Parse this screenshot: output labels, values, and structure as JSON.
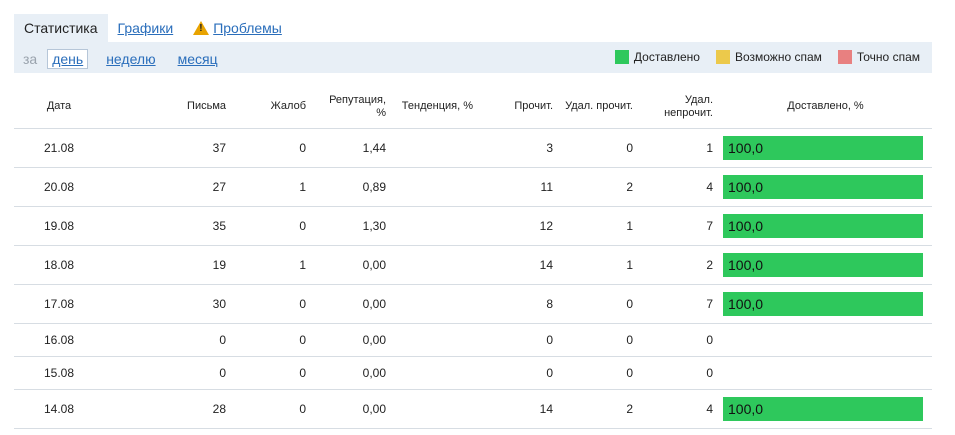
{
  "tabs": [
    {
      "label": "Статистика"
    },
    {
      "label": "Графики"
    },
    {
      "label": "Проблемы"
    }
  ],
  "period": {
    "prefix": "за",
    "options": [
      "день",
      "неделю",
      "месяц"
    ],
    "selected": "день"
  },
  "legend": [
    {
      "label": "Доставлено",
      "color": "#2ec85c"
    },
    {
      "label": "Возможно спам",
      "color": "#ecc94b"
    },
    {
      "label": "Точно спам",
      "color": "#e88080"
    }
  ],
  "table": {
    "headers": [
      "Дата",
      "Письма",
      "Жалоб",
      "Репутация, %",
      "Тенденция, %",
      "Прочит.",
      "Удал. прочит.",
      "Удал. непрочит.",
      "Доставлено, %"
    ],
    "rows": [
      {
        "date": "21.08",
        "letters": "37",
        "complaints": "0",
        "reputation": "1,44",
        "trend": "",
        "read": "3",
        "del_read": "0",
        "del_unread": "1",
        "delivered": "100,0"
      },
      {
        "date": "20.08",
        "letters": "27",
        "complaints": "1",
        "reputation": "0,89",
        "trend": "",
        "read": "11",
        "del_read": "2",
        "del_unread": "4",
        "delivered": "100,0"
      },
      {
        "date": "19.08",
        "letters": "35",
        "complaints": "0",
        "reputation": "1,30",
        "trend": "",
        "read": "12",
        "del_read": "1",
        "del_unread": "7",
        "delivered": "100,0"
      },
      {
        "date": "18.08",
        "letters": "19",
        "complaints": "1",
        "reputation": "0,00",
        "trend": "",
        "read": "14",
        "del_read": "1",
        "del_unread": "2",
        "delivered": "100,0"
      },
      {
        "date": "17.08",
        "letters": "30",
        "complaints": "0",
        "reputation": "0,00",
        "trend": "",
        "read": "8",
        "del_read": "0",
        "del_unread": "7",
        "delivered": "100,0"
      },
      {
        "date": "16.08",
        "letters": "0",
        "complaints": "0",
        "reputation": "0,00",
        "trend": "",
        "read": "0",
        "del_read": "0",
        "del_unread": "0",
        "delivered": ""
      },
      {
        "date": "15.08",
        "letters": "0",
        "complaints": "0",
        "reputation": "0,00",
        "trend": "",
        "read": "0",
        "del_read": "0",
        "del_unread": "0",
        "delivered": ""
      },
      {
        "date": "14.08",
        "letters": "28",
        "complaints": "0",
        "reputation": "0,00",
        "trend": "",
        "read": "14",
        "del_read": "2",
        "del_unread": "4",
        "delivered": "100,0"
      }
    ]
  }
}
